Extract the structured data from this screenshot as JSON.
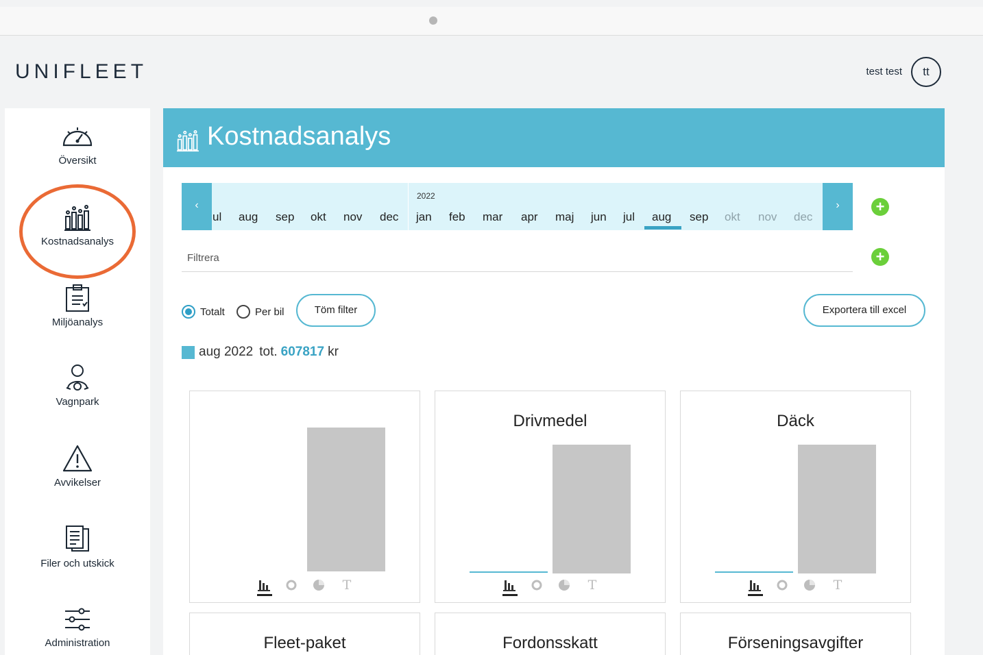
{
  "app": {
    "logo": "UNIFLEET"
  },
  "user": {
    "name": "test test",
    "initials": "tt"
  },
  "sidebar": {
    "items": [
      {
        "label": "Översikt"
      },
      {
        "label": "Kostnadsanalys"
      },
      {
        "label": "Miljöanalys"
      },
      {
        "label": "Vagnpark"
      },
      {
        "label": "Avvikelser"
      },
      {
        "label": "Filer och utskick"
      },
      {
        "label": "Administration"
      }
    ]
  },
  "page": {
    "title": "Kostnadsanalys"
  },
  "months": {
    "prev_arrow": "‹",
    "next_arrow": "›",
    "year": "2022",
    "prev_year": [
      "ul",
      "aug",
      "sep",
      "okt",
      "nov",
      "dec"
    ],
    "current_year": [
      "jan",
      "feb",
      "mar",
      "apr",
      "maj",
      "jun",
      "jul",
      "aug",
      "sep",
      "okt",
      "nov",
      "dec"
    ],
    "selected": "aug"
  },
  "filter": {
    "placeholder": "Filtrera"
  },
  "options": {
    "total_label": "Totalt",
    "per_car_label": "Per bil",
    "selected": "Totalt"
  },
  "buttons": {
    "clear_filter": "Töm filter",
    "export_excel": "Exportera till excel",
    "add": "+"
  },
  "summary": {
    "period": "aug 2022",
    "tot_label": "tot.",
    "total": "607817",
    "unit": "kr"
  },
  "colors": {
    "accent": "#56b8d2",
    "add_button": "#6bcf3a",
    "highlight_ring": "#ea6a35",
    "bar": "#c6c6c6"
  },
  "cards": [
    {
      "title": ""
    },
    {
      "title": "Drivmedel"
    },
    {
      "title": "Däck"
    },
    {
      "title": "Fleet-paket"
    },
    {
      "title": "Fordonsskatt"
    },
    {
      "title": "Förseningsavgifter"
    }
  ],
  "chart_tool_icons": [
    "bar-chart-icon",
    "donut-chart-icon",
    "pie-chart-icon",
    "text-view-icon"
  ],
  "tool_text_glyph": "T"
}
